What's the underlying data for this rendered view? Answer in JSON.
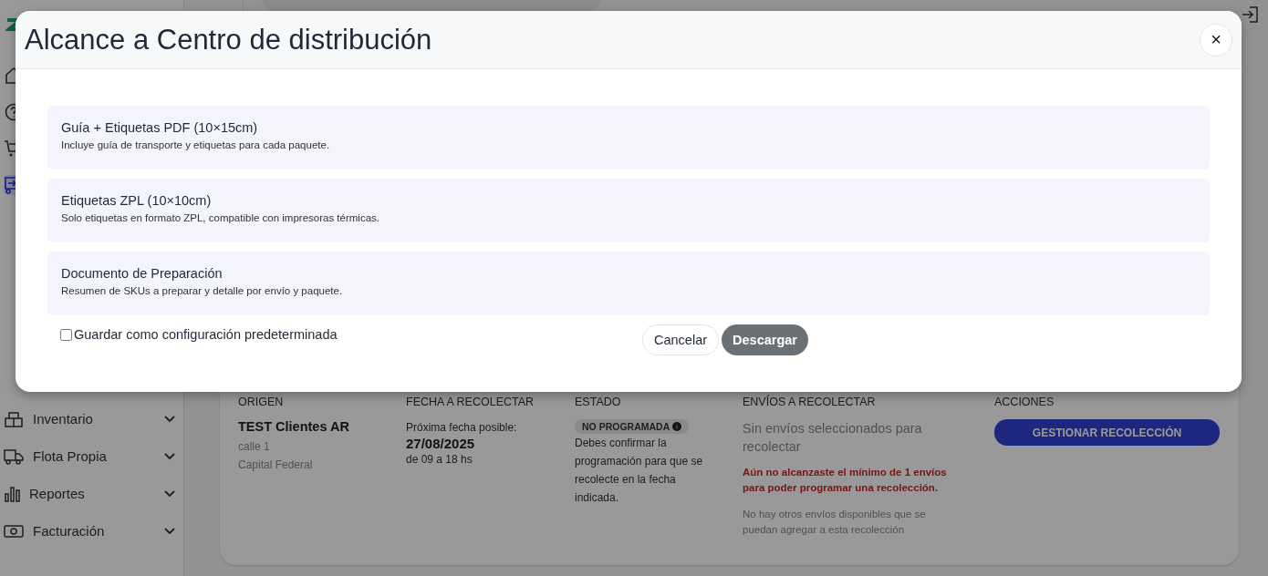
{
  "sidebar": {
    "icon_items": [
      {
        "kind": "home",
        "selected": false
      },
      {
        "kind": "help",
        "selected": false
      },
      {
        "kind": "cart",
        "selected": false
      },
      {
        "kind": "pickup",
        "selected": true
      }
    ],
    "items": [
      {
        "label": "Inventario",
        "kind": "inventory",
        "expanded": false
      },
      {
        "label": "Flota Propia",
        "kind": "truck",
        "expanded": false
      },
      {
        "label": "Reportes",
        "kind": "chart",
        "expanded": false
      },
      {
        "label": "Facturación",
        "kind": "money",
        "expanded": false
      }
    ]
  },
  "table": {
    "columns": [
      "ORIGEN",
      "FECHA A RECOLECTAR",
      "ESTADO",
      "ENVÍOS A RECOLECTAR",
      "ACCIONES"
    ],
    "row": {
      "origin_name": "TEST Clientes AR",
      "origin_street": "calle 1",
      "origin_city": "Capital Federal",
      "date_label": "Próxima fecha posible:",
      "date": "27/08/2025",
      "hours": "de 09 a 18 hs",
      "status_badge": "NO PROGRAMADA",
      "status_text": "Debes confirmar la programación para que se recolecte en la fecha indicada.",
      "shipments": "Sin envíos seleccionados para recolectar",
      "warning": "Aún no alcanzaste el mínimo de 1 envíos para poder programar una recolección.",
      "note": "No hay otros envíos disponibles que se puedan agregar a esta recolección",
      "action": "GESTIONAR RECOLECCIÓN"
    }
  },
  "modal": {
    "title": "Alcance a Centro de distribución",
    "close": "×",
    "options": [
      {
        "title": "Guía + Etiquetas PDF (10×15cm)",
        "description": "Incluye guía de transporte y etiquetas para cada paquete."
      },
      {
        "title": "Etiquetas ZPL (10×10cm)",
        "description": "Solo etiquetas en formato ZPL, compatible con impresoras térmicas."
      },
      {
        "title": "Documento de Preparación",
        "description": "Resumen de SKUs a preparar y detalle por envío y paquete."
      }
    ],
    "checkbox": {
      "label": "Guardar como configuración predeterminada",
      "checked": false
    },
    "buttons": [
      {
        "label": "Cancelar",
        "kind": "secondary",
        "disabled": false
      },
      {
        "label": "Descargar",
        "kind": "primary",
        "disabled": true
      }
    ]
  }
}
